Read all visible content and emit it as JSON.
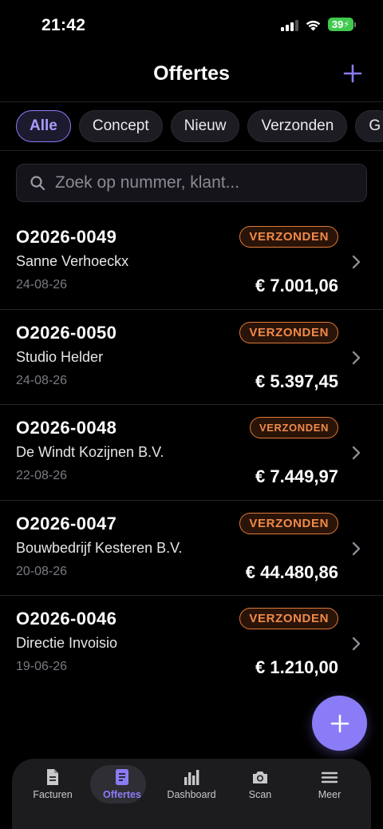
{
  "status": {
    "time": "21:42",
    "battery": "39"
  },
  "header": {
    "title": "Offertes"
  },
  "filters": [
    "Alle",
    "Concept",
    "Nieuw",
    "Verzonden",
    "G"
  ],
  "search": {
    "placeholder": "Zoek op nummer, klant..."
  },
  "quotes": [
    {
      "number": "O2026-0049",
      "client": "Sanne Verhoeckx",
      "date": "24-08-26",
      "status": "VERZONDEN",
      "amount": "€ 7.001,06"
    },
    {
      "number": "O2026-0050",
      "client": "Studio Helder",
      "date": "24-08-26",
      "status": "VERZONDEN",
      "amount": "€ 5.397,45"
    },
    {
      "number": "O2026-0048",
      "client": "De Windt Kozijnen B.V.",
      "date": "22-08-26",
      "status": "VERZONDEN",
      "amount": "€ 7.449,97"
    },
    {
      "number": "O2026-0047",
      "client": "Bouwbedrijf Kesteren B.V.",
      "date": "20-08-26",
      "status": "VERZONDEN",
      "amount": "€ 44.480,86"
    },
    {
      "number": "O2026-0046",
      "client": "Directie Invoisio",
      "date": "19-06-26",
      "status": "VERZONDEN",
      "amount": "€ 1.210,00"
    }
  ],
  "tabs": [
    {
      "label": "Facturen",
      "icon": "document-icon"
    },
    {
      "label": "Offertes",
      "icon": "quote-document-icon"
    },
    {
      "label": "Dashboard",
      "icon": "bar-chart-icon"
    },
    {
      "label": "Scan",
      "icon": "camera-icon"
    },
    {
      "label": "Meer",
      "icon": "menu-icon"
    }
  ],
  "colors": {
    "accent": "#8a7cf6",
    "status_sent": "#f08a4a",
    "background": "#000000"
  }
}
